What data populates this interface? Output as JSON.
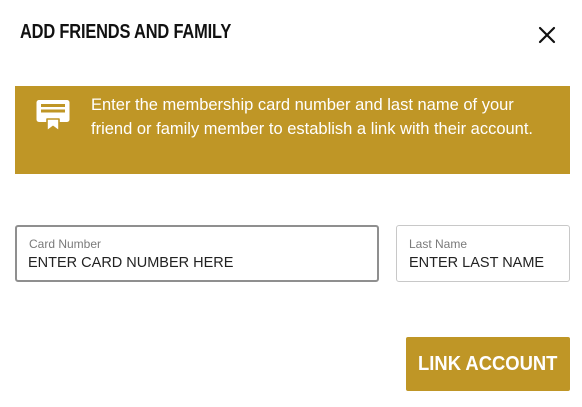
{
  "dialog": {
    "title": "ADD FRIENDS AND FAMILY",
    "close_icon": "close-icon"
  },
  "info_banner": {
    "icon": "membership-card-icon",
    "text": "Enter the membership card number and last name of your friend or family member to establish a link with their account."
  },
  "form": {
    "card_number": {
      "label": "Card Number",
      "placeholder": "ENTER CARD NUMBER HERE",
      "value": ""
    },
    "last_name": {
      "label": "Last Name",
      "placeholder": "ENTER LAST NAME",
      "value": ""
    }
  },
  "actions": {
    "link_account_label": "LINK ACCOUNT"
  },
  "colors": {
    "accent": "#bf9626",
    "text": "#222222",
    "label": "#7a7a7a"
  }
}
